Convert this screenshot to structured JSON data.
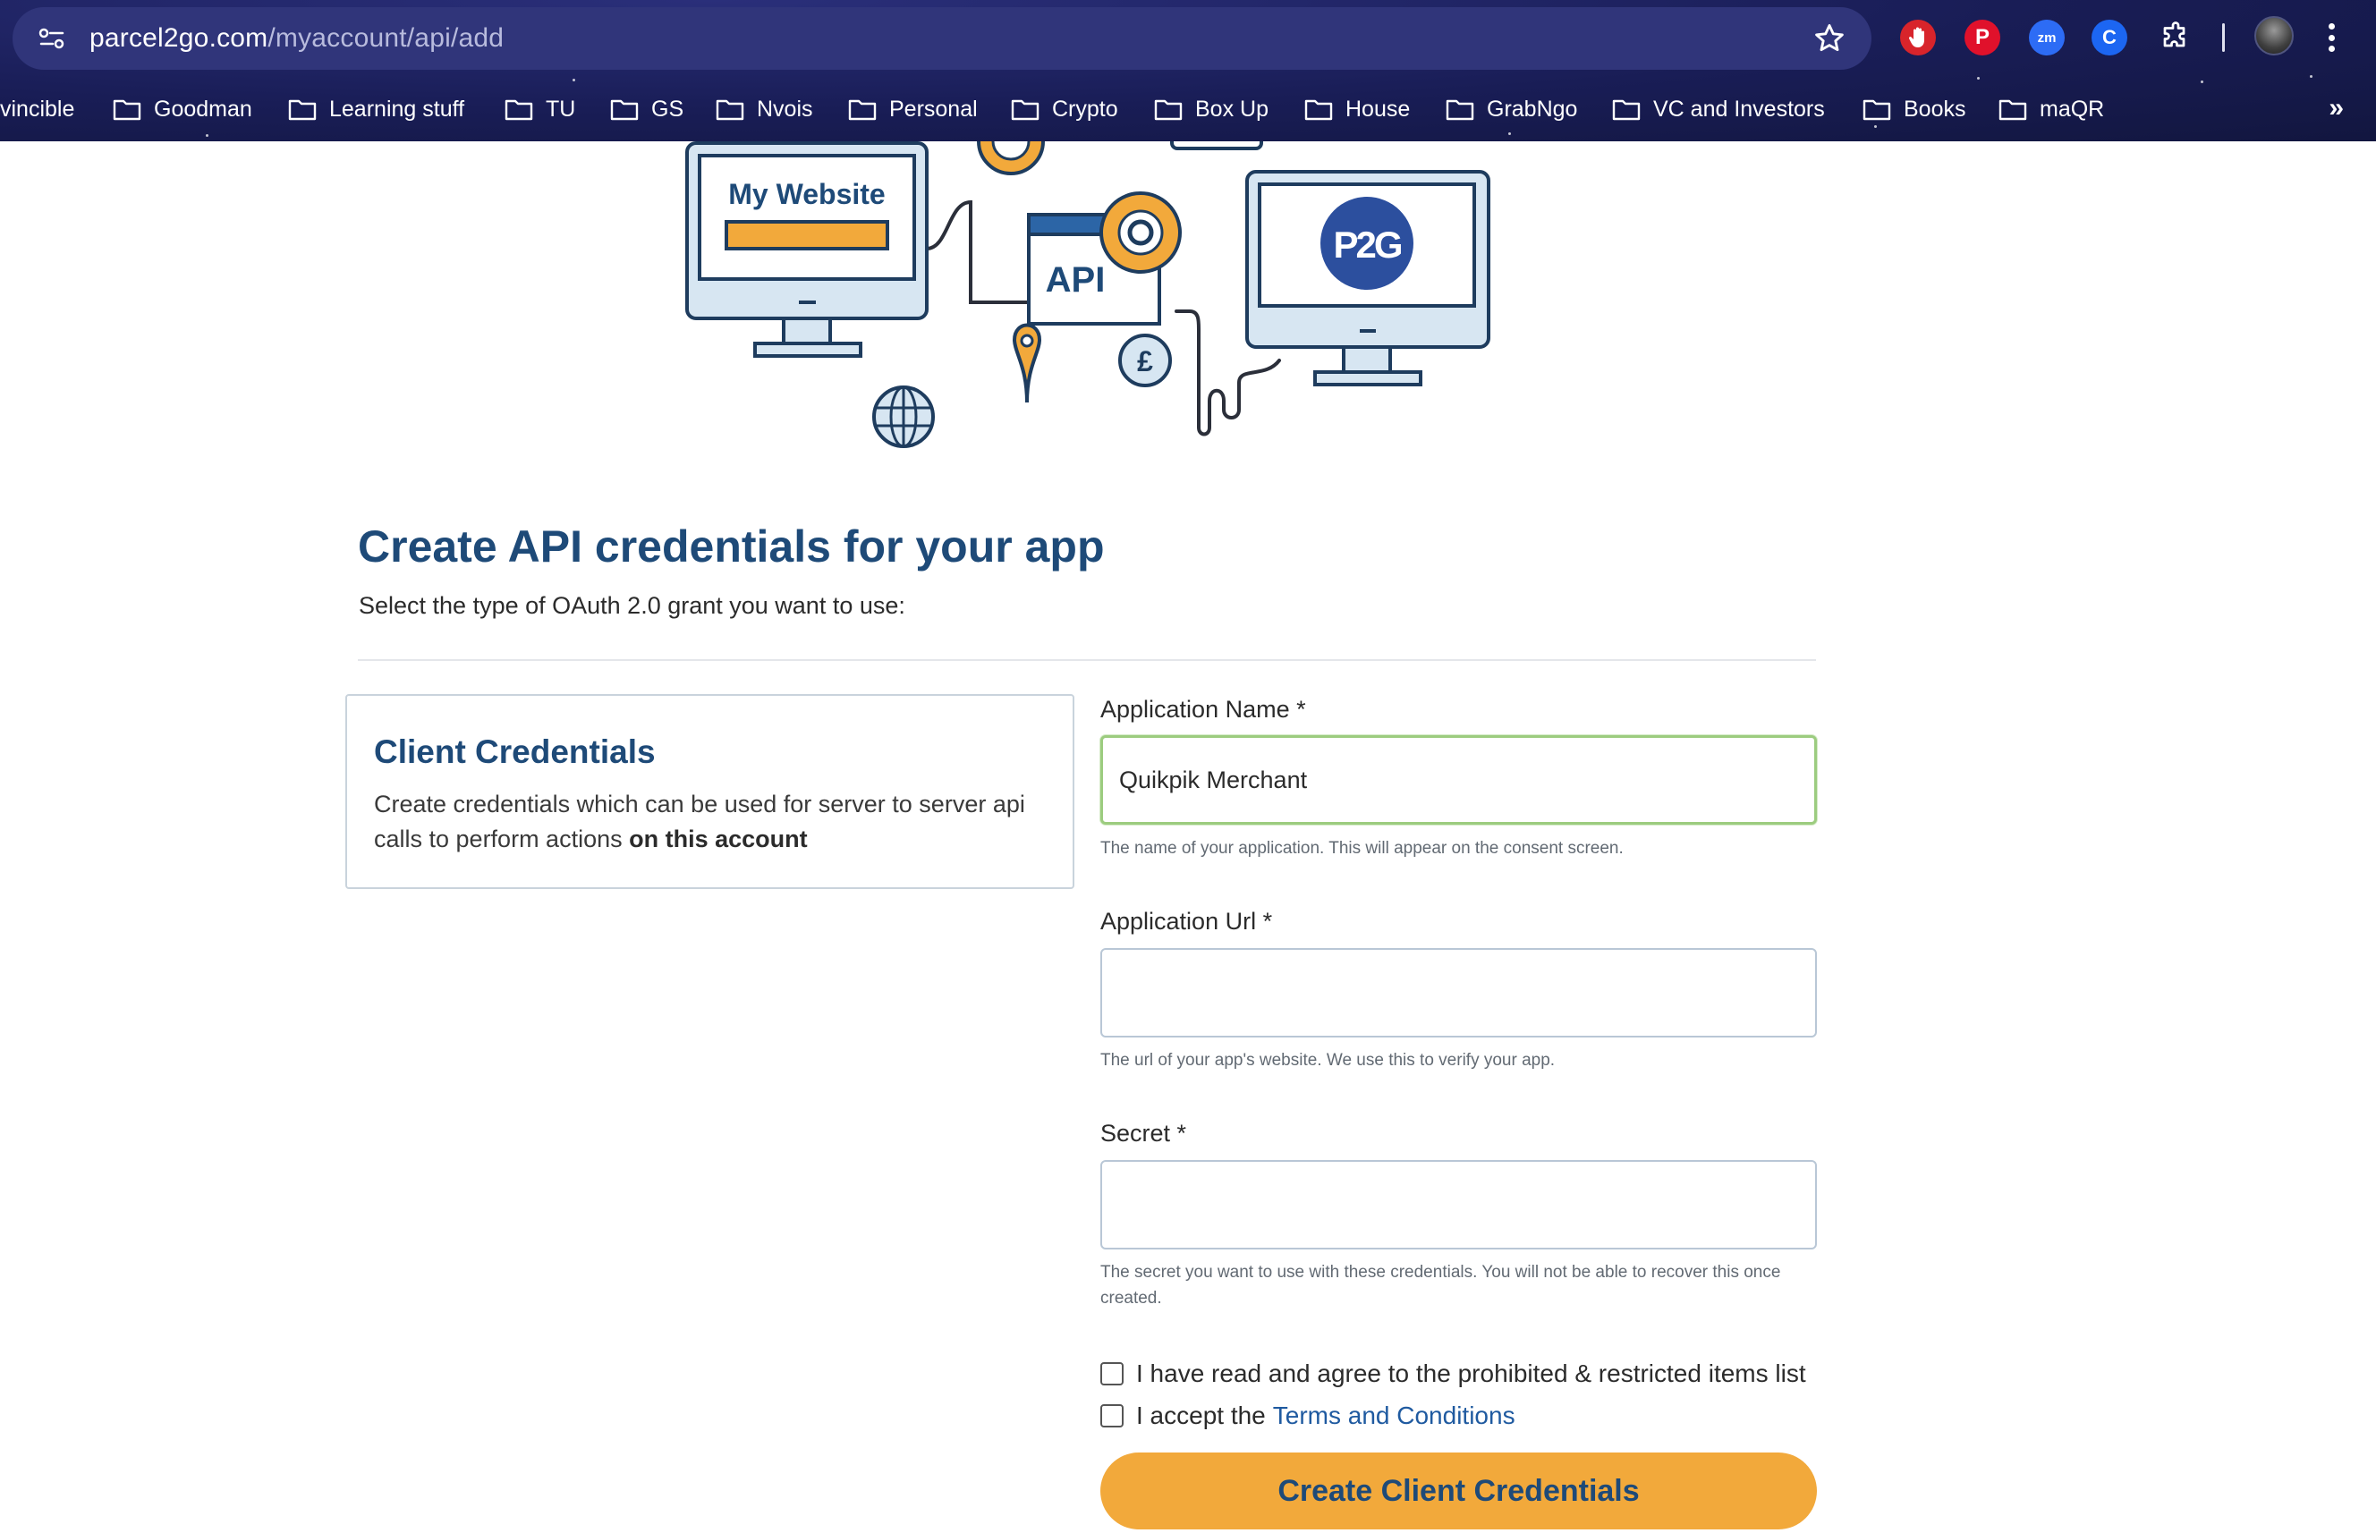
{
  "browser": {
    "url_host": "parcel2go.com",
    "url_path": "/myaccount/api/add",
    "extensions": {
      "adblock": "adblock-icon",
      "pinterest": "P",
      "zoom": "zm",
      "other": "C"
    },
    "bookmarks": [
      "vincible",
      "Goodman",
      "Learning stuff",
      "TU",
      "GS",
      "Nvois",
      "Personal",
      "Crypto",
      "Box Up",
      "House",
      "GrabNgo",
      "VC and Investors",
      "Books",
      "maQR"
    ],
    "more_bookmarks": "»"
  },
  "hero": {
    "website_label": "My Website",
    "api_label": "API",
    "logo_label": "P2G",
    "currency_symbol": "£"
  },
  "page": {
    "title": "Create API credentials for your app",
    "subtitle": "Select the type of OAuth 2.0 grant you want to use:"
  },
  "grant_card": {
    "title": "Client Credentials",
    "description": "Create credentials which can be used for server to server api calls to perform actions",
    "description_bold": "on this account"
  },
  "form": {
    "app_name": {
      "label": "Application Name *",
      "value": "Quikpik Merchant",
      "help": "The name of your application. This will appear on the consent screen."
    },
    "app_url": {
      "label": "Application Url *",
      "value": "",
      "help": "The url of your app's website. We use this to verify your app."
    },
    "secret": {
      "label": "Secret *",
      "value": "",
      "help": "The secret you want to use with these credentials. You will not be able to recover this once created."
    },
    "agree_items_label": "I have read and agree to the prohibited & restricted items list",
    "accept_terms_prefix": "I accept the",
    "terms_link": "Terms and Conditions",
    "submit_label": "Create Client Credentials"
  },
  "colors": {
    "brand_navy": "#1e4a78",
    "accent_orange": "#f2a93b",
    "focus_green": "#9ccc7f",
    "link_blue": "#1f5aa0"
  }
}
